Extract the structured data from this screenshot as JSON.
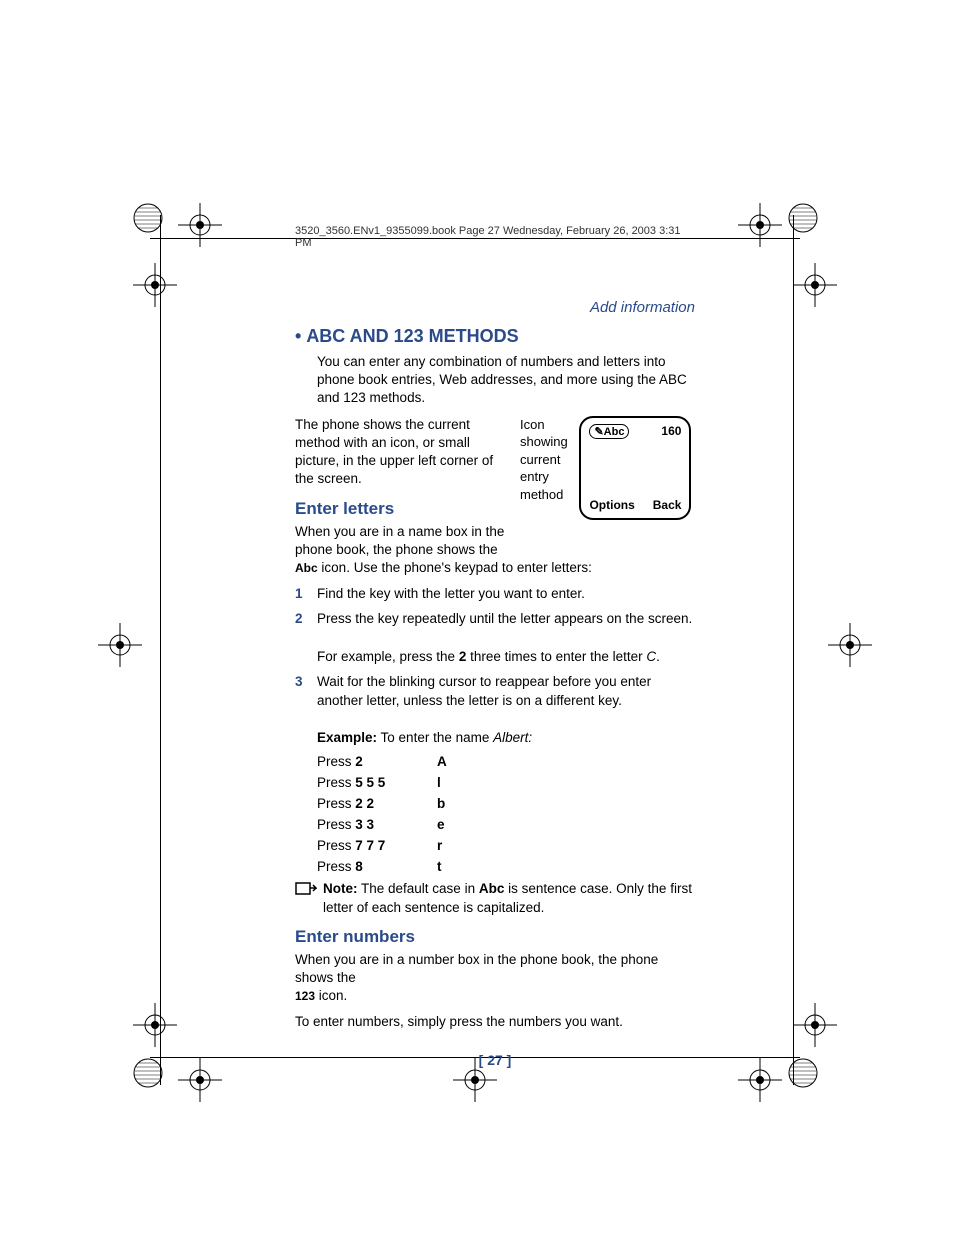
{
  "header": "3520_3560.ENv1_9355099.book  Page 27  Wednesday, February 26, 2003  3:31 PM",
  "running_head": "Add information",
  "main_heading": "ABC AND 123 METHODS",
  "intro_para": "You can enter any combination of numbers and letters into phone book entries, Web addresses, and more using the ABC and 123 methods.",
  "method_para": "The phone shows the current method with an icon, or small picture, in the upper left corner of the screen.",
  "screen_callout": "Icon showing current entry method",
  "screen": {
    "icon_label": "Abc",
    "count": "160",
    "left_soft": "Options",
    "right_soft": "Back"
  },
  "enter_letters": {
    "title": "Enter letters",
    "intro_a": "When you are in a name box in the phone book, the phone shows the",
    "abc_icon": "Abc",
    "intro_b": " icon. Use the phone's keypad to enter letters:",
    "steps": [
      "Find the key with the letter you want to enter.",
      "Press the key repeatedly until the letter appears on the screen.",
      "Wait for the blinking cursor to reappear before you enter another letter, unless the letter is on a different key."
    ],
    "example_pre": "For example, press the ",
    "example_key": "2",
    "example_post_a": " three times to enter the letter ",
    "example_post_b": "C",
    "example_post_c": ".",
    "example_label": "Example:",
    "example_text": " To enter the name ",
    "example_name": "Albert:",
    "table": [
      {
        "press": "Press ",
        "keys": "2",
        "letter": "A"
      },
      {
        "press": "Press ",
        "keys": "5 5 5",
        "letter": "l"
      },
      {
        "press": "Press ",
        "keys": "2 2",
        "letter": "b"
      },
      {
        "press": "Press ",
        "keys": "3 3",
        "letter": "e"
      },
      {
        "press": "Press ",
        "keys": "7 7 7",
        "letter": "r"
      },
      {
        "press": "Press ",
        "keys": "8",
        "letter": "t"
      }
    ],
    "note_label": "Note:",
    "note_a": " The default case in ",
    "note_bold": "Abc",
    "note_b": " is sentence case. Only the first letter of each sentence is capitalized."
  },
  "enter_numbers": {
    "title": "Enter numbers",
    "intro_a": "When you are in a number box in the phone book, the phone shows the ",
    "icon": "123",
    "intro_b": " icon.",
    "body": "To enter numbers, simply press the numbers you want."
  },
  "page_number": "[ 27 ]"
}
